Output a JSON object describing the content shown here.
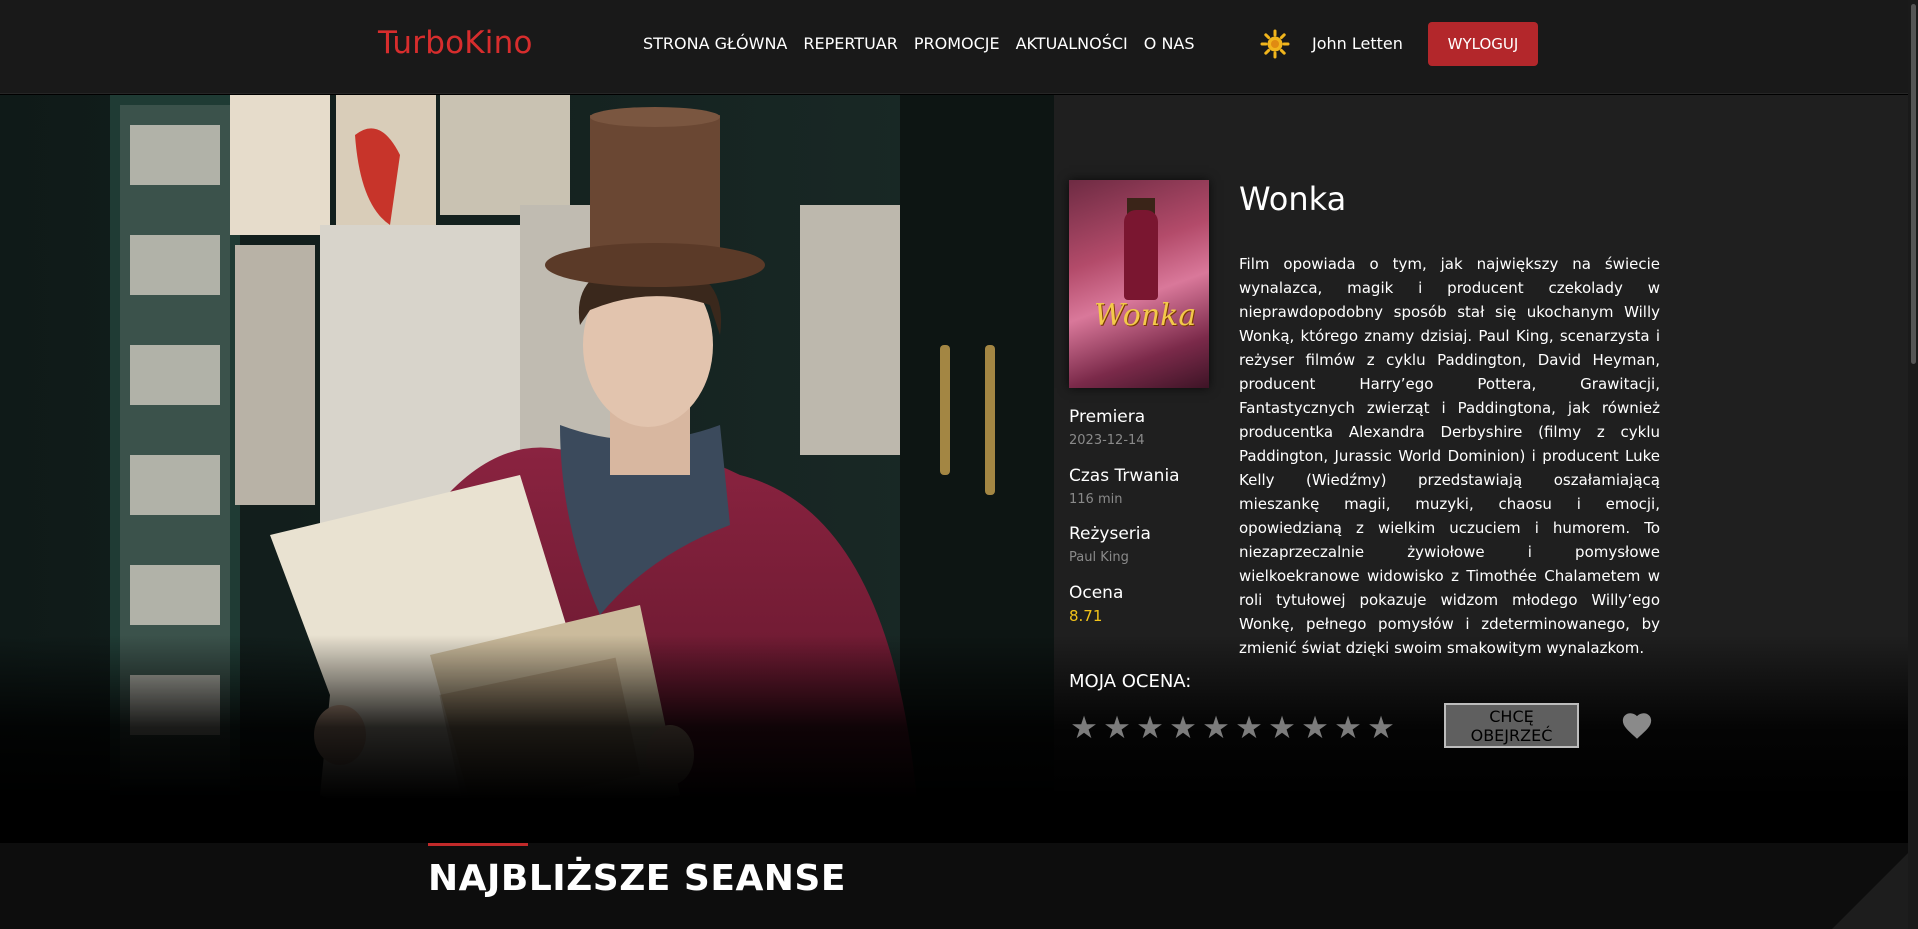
{
  "header": {
    "logo": "TurboKino",
    "nav": [
      "STRONA GŁÓWNA",
      "REPERTUAR",
      "PROMOCJE",
      "AKTUALNOŚCI",
      "O NAS"
    ],
    "theme_icon": "sun-icon",
    "username": "John Letten",
    "logout_label": "WYLOGUJ"
  },
  "movie": {
    "title": "Wonka",
    "poster_title": "Wonka",
    "description": "Film opowiada o tym, jak największy na świecie wynalazca, magik i producent czekolady w nieprawdopodobny sposób stał się ukochanym Willy Wonką, którego znamy dzisiaj. Paul King, scenarzysta i reżyser filmów z cyklu Paddington, David Heyman, producent Harry’ego Pottera, Grawitacji, Fantastycznych zwierząt i Paddingtona, jak również producentka Alexandra Derbyshire (filmy z cyklu Paddington, Jurassic World Dominion) i producent Luke Kelly (Wiedźmy) przedstawiają oszałamiającą mieszankę magii, muzyki, chaosu i emocji, opowiedzianą z wielkim uczuciem i humorem. To niezaprzeczalnie żywiołowe i pomysłowe wielkoekranowe widowisko z Timothée Chalametem w roli tytułowej pokazuje widzom młodego Willy’ego Wonkę, pełnego pomysłów i zdeterminowanego, by zmienić świat dzięki swoim smakowitym wynalazkom.",
    "premiere_label": "Premiera",
    "premiere_value": "2023-12-14",
    "duration_label": "Czas Trwania",
    "duration_value": "116 min",
    "director_label": "Reżyseria",
    "director_value": "Paul King",
    "rating_label": "Ocena",
    "rating_value": "8.71"
  },
  "user_rating": {
    "label": "MOJA OCENA:",
    "star_glyph": "★",
    "max_stars": 10,
    "selected": 0,
    "want_label": "CHCĘ OBEJRZEĆ",
    "heart_icon": "heart-icon"
  },
  "section": {
    "title": "NAJBLIŻSZE SEANSE"
  },
  "colors": {
    "accent": "#d72d2d",
    "button": "#b3272b",
    "rating": "#f2c319"
  }
}
